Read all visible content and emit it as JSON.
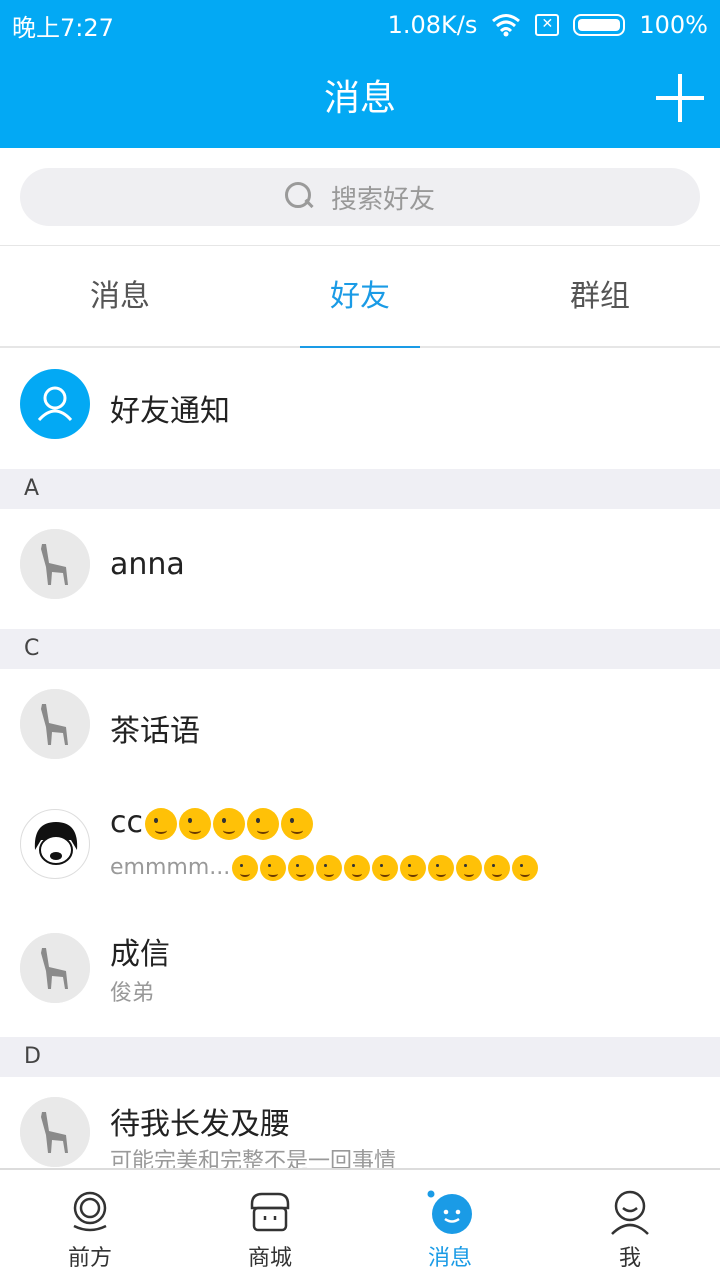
{
  "status_bar": {
    "time": "晚上7:27",
    "speed": "1.08K/s",
    "battery": "100%"
  },
  "app_bar": {
    "title": "消息"
  },
  "search": {
    "placeholder": "搜索好友"
  },
  "tabs": [
    {
      "label": "消息",
      "active": false
    },
    {
      "label": "好友",
      "active": true
    },
    {
      "label": "群组",
      "active": false
    }
  ],
  "friend_notice": {
    "label": "好友通知"
  },
  "sections": [
    {
      "letter": "A",
      "contacts": [
        {
          "name": "anna",
          "sub": ""
        }
      ]
    },
    {
      "letter": "C",
      "contacts": [
        {
          "name": "茶话语",
          "sub": ""
        },
        {
          "name": "cc",
          "sub": "emmmm..."
        },
        {
          "name": "成信",
          "sub": "俊弟"
        }
      ]
    },
    {
      "letter": "D",
      "contacts": [
        {
          "name": "待我长发及腰",
          "sub": "可能完美和完整不是一回事情"
        }
      ]
    }
  ],
  "bottom_nav": [
    {
      "label": "前方",
      "active": false
    },
    {
      "label": "商城",
      "active": false
    },
    {
      "label": "消息",
      "active": true
    },
    {
      "label": "我",
      "active": false
    }
  ],
  "colors": {
    "primary": "#03A9F4",
    "active_text": "#1a9be6",
    "section_bg": "#efeff4"
  }
}
